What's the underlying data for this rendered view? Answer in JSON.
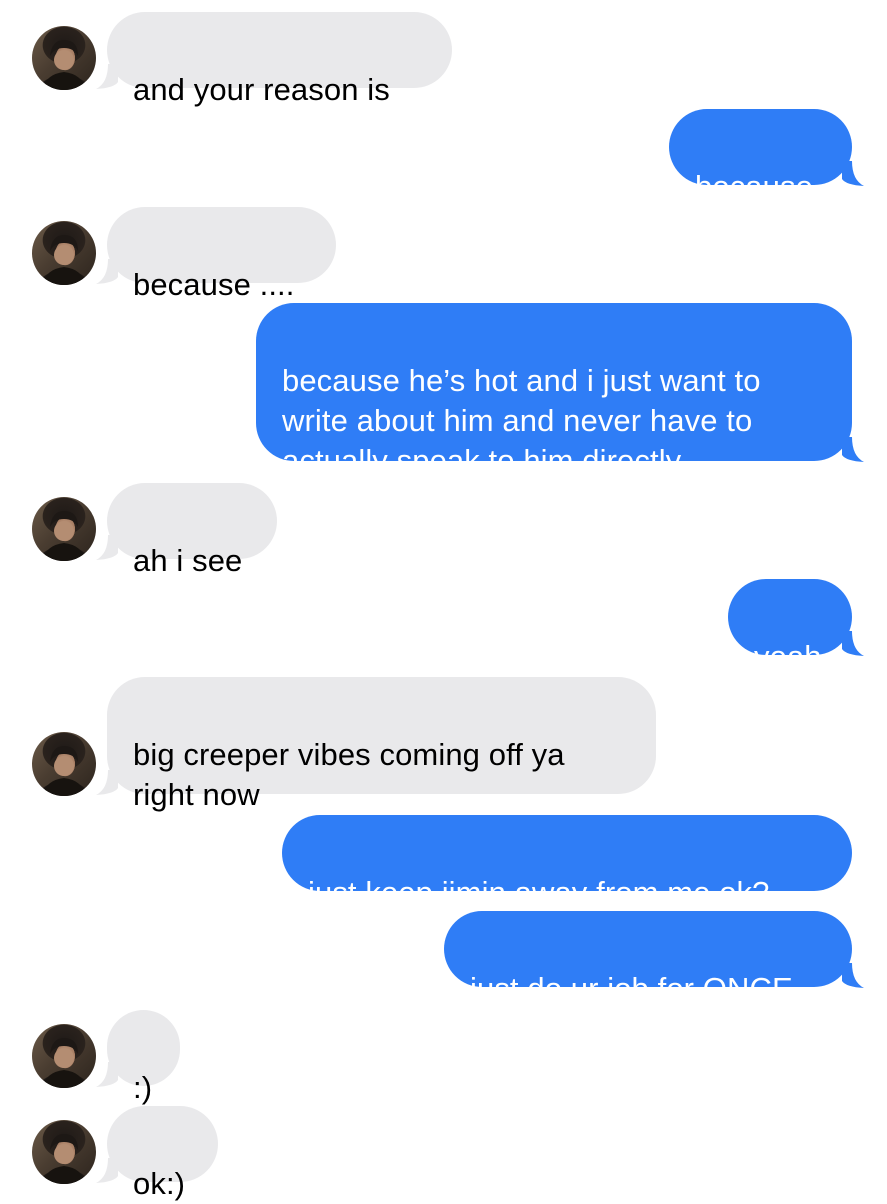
{
  "conversation": {
    "contact_avatar": "person-portrait",
    "colors": {
      "incoming_bubble": "#e9e9eb",
      "outgoing_bubble": "#2f7df6",
      "incoming_text": "#000000",
      "outgoing_text": "#ffffff"
    },
    "messages": [
      {
        "direction": "incoming",
        "text": "and your reason is"
      },
      {
        "direction": "outgoing",
        "text": "because"
      },
      {
        "direction": "incoming",
        "text": "because ...."
      },
      {
        "direction": "outgoing",
        "text": "because he’s hot and i just want to\nwrite about him and never have to\nactually speak to him directly"
      },
      {
        "direction": "incoming",
        "text": "ah i see"
      },
      {
        "direction": "outgoing",
        "text": "yeah"
      },
      {
        "direction": "incoming",
        "text": "big creeper vibes coming off ya\nright now"
      },
      {
        "direction": "outgoing",
        "text": "just keep jimin away from me ok?"
      },
      {
        "direction": "outgoing",
        "text": "just do ur job for ONCE"
      },
      {
        "direction": "incoming",
        "text": ":)"
      },
      {
        "direction": "incoming",
        "text": "ok:)"
      }
    ]
  }
}
